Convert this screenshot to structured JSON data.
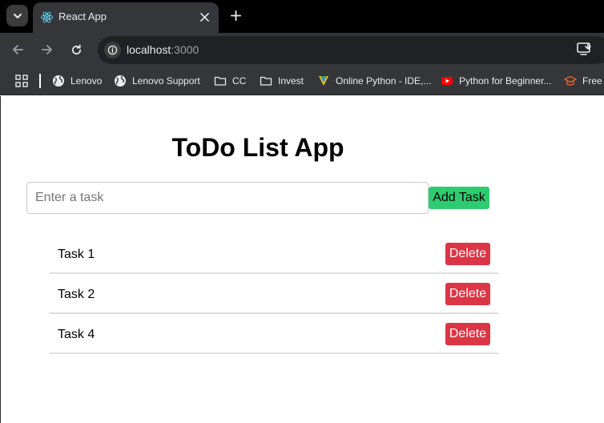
{
  "browser": {
    "tab_title": "React App",
    "url_host": "localhost",
    "url_port": ":3000",
    "bookmarks": [
      {
        "label": "Lenovo",
        "icon": "globe-icon"
      },
      {
        "label": "Lenovo Support",
        "icon": "globe-icon"
      },
      {
        "label": "CC",
        "icon": "folder-icon"
      },
      {
        "label": "Invest",
        "icon": "folder-icon"
      },
      {
        "label": "Online Python - IDE,...",
        "icon": "python-ide-icon"
      },
      {
        "label": "Python for Beginner...",
        "icon": "youtube-icon"
      },
      {
        "label": "Free A",
        "icon": "graduation-cap-icon"
      }
    ]
  },
  "app": {
    "title": "ToDo List App",
    "input_placeholder": "Enter a task",
    "input_value": "",
    "add_label": "Add Task",
    "delete_label": "Delete",
    "tasks": [
      "Task 1",
      "Task 2",
      "Task 4"
    ]
  },
  "colors": {
    "add_button": "#2ecc71",
    "delete_button": "#dc3545",
    "chrome_dark": "#35363a",
    "tabstrip": "#000000"
  }
}
